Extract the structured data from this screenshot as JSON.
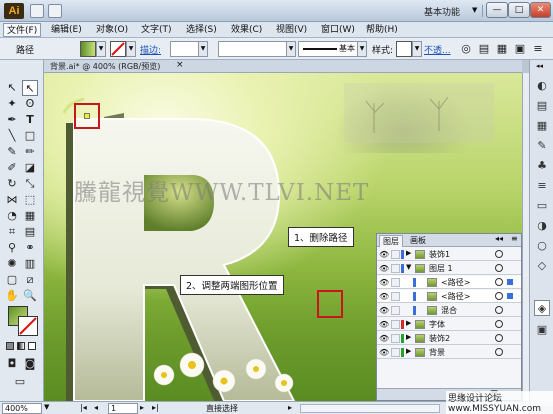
{
  "app": {
    "logo": "Ai",
    "workspace": "基本功能"
  },
  "window_buttons": {
    "minimize": "—",
    "restore": "□",
    "close": "✕"
  },
  "menu": [
    "文件(F)",
    "编辑(E)",
    "对象(O)",
    "文字(T)",
    "选择(S)",
    "效果(C)",
    "视图(V)",
    "窗口(W)",
    "帮助(H)"
  ],
  "control": {
    "mode": "路径",
    "stroke_label": "描边:",
    "stroke_style": "基本",
    "style_label": "样式:",
    "opacity_label": "不透..."
  },
  "document_tab": {
    "label": "背景.ai* @ 400% (RGB/预览)",
    "close": "×"
  },
  "canvas": {
    "watermark": "騰龍視覺WWW.TLVI.NET",
    "colors": {
      "grass": "#7aa835",
      "letter": "#e9ecdd"
    }
  },
  "callouts": {
    "delete_path": "1、删除路径",
    "adjust_shapes": "2、调整两端图形位置"
  },
  "layers_panel": {
    "tabs": [
      "图层",
      "画板"
    ],
    "rows": [
      {
        "name": "装饰1",
        "indent": 0,
        "color": "#3a6fd8",
        "expanded": false,
        "selected": false
      },
      {
        "name": "图层 1",
        "indent": 0,
        "color": "#3a6fd8",
        "expanded": true,
        "selected": false
      },
      {
        "name": "<路径>",
        "indent": 1,
        "color": "#3a6fd8",
        "expanded": false,
        "selected": true
      },
      {
        "name": "<路径>",
        "indent": 1,
        "color": "#3a6fd8",
        "expanded": false,
        "selected": true
      },
      {
        "name": "混合",
        "indent": 1,
        "color": "#3a6fd8",
        "expanded": false,
        "selected": false
      },
      {
        "name": "字体",
        "indent": 0,
        "color": "#d22c2c",
        "expanded": false,
        "selected": false
      },
      {
        "name": "装饰2",
        "indent": 0,
        "color": "#2ca02c",
        "expanded": false,
        "selected": false
      },
      {
        "name": "背景",
        "indent": 0,
        "color": "#2ca02c",
        "expanded": false,
        "selected": false
      }
    ]
  },
  "status": {
    "zoom": "400%",
    "page": "1",
    "tool": "直接选择"
  },
  "site": "思缘设计论坛 www.MISSYUAN.com"
}
